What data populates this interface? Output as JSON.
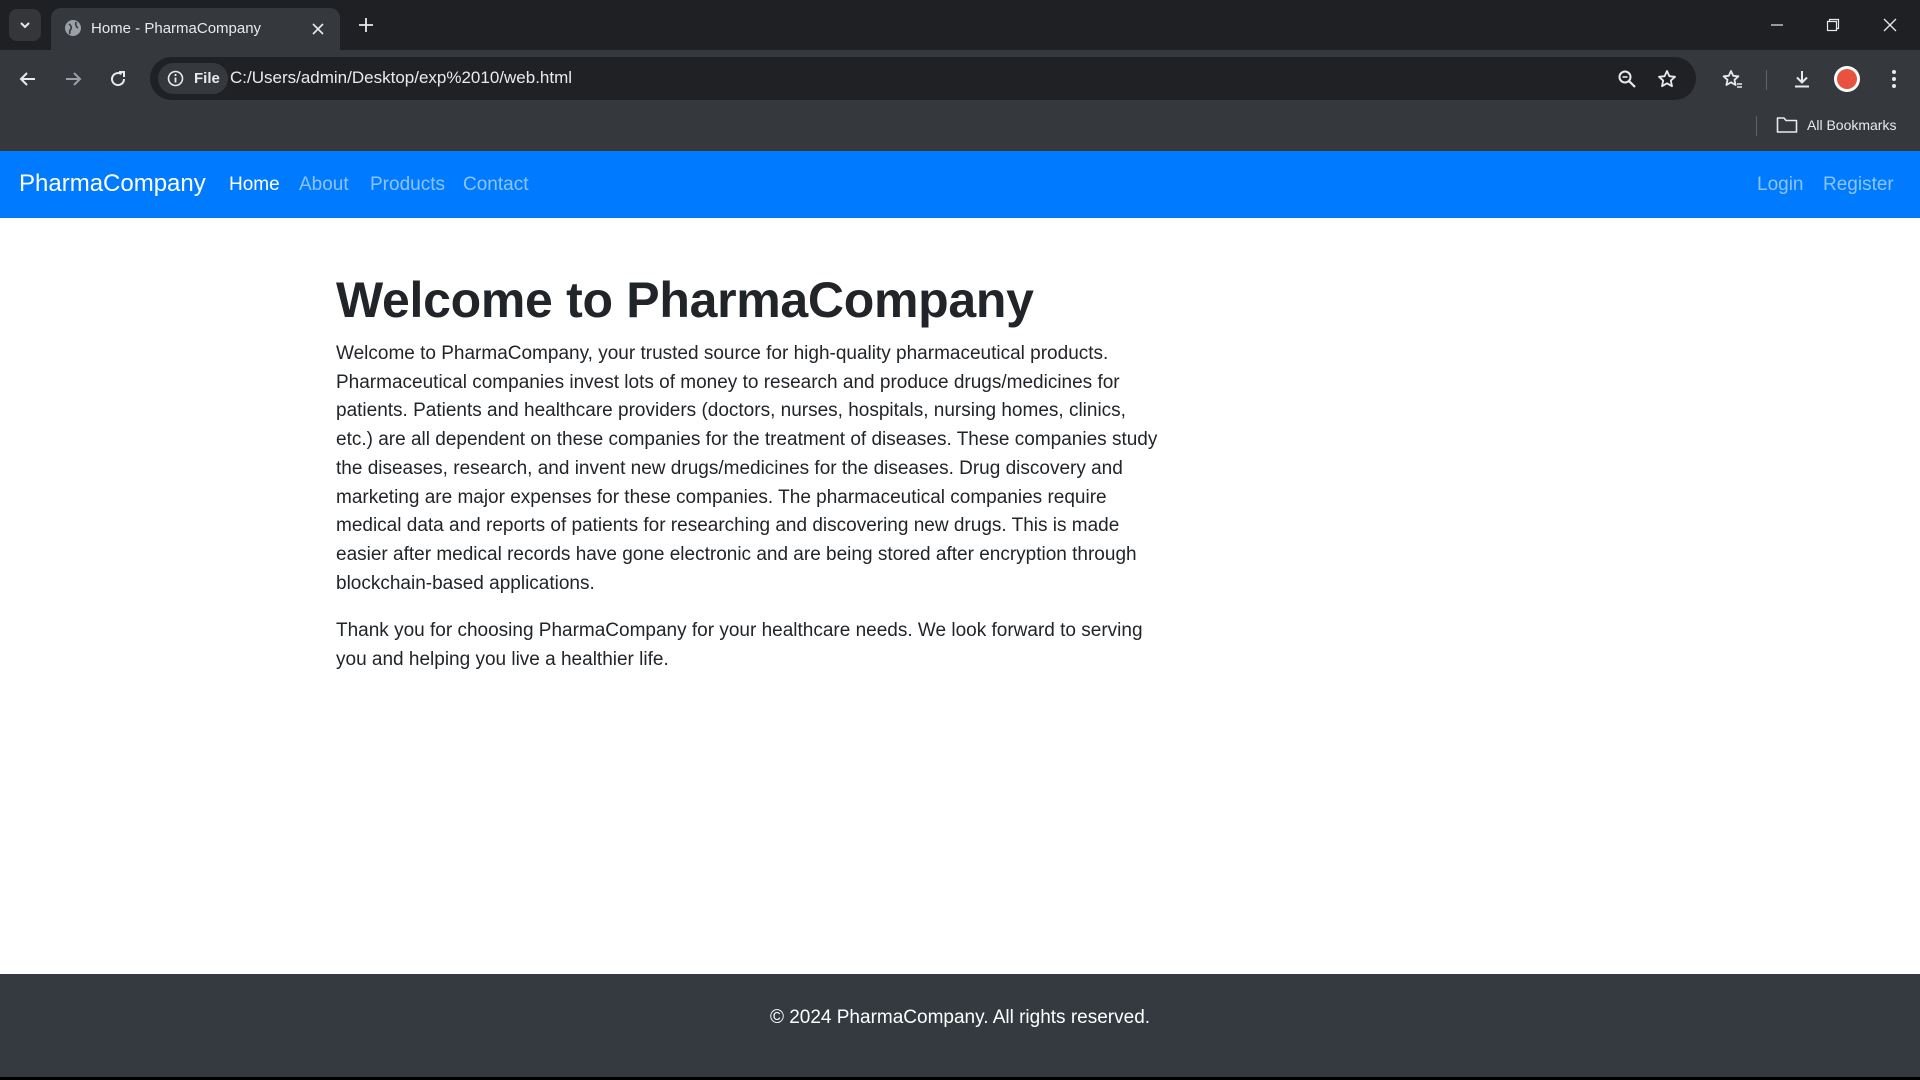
{
  "browser": {
    "tab_title": "Home - PharmaCompany",
    "site_chip_label": "File",
    "url": "C:/Users/admin/Desktop/exp%2010/web.html",
    "bookmarks_label": "All Bookmarks",
    "icons": {
      "tab_menu": "chevron-down-icon",
      "tab_favicon": "globe-icon",
      "tab_close": "close-icon",
      "new_tab": "plus-icon",
      "minimize": "minimize-icon",
      "restore": "restore-icon",
      "close_window": "close-icon",
      "back": "back-arrow-icon",
      "forward": "forward-arrow-icon",
      "reload": "reload-icon",
      "site_info": "info-icon",
      "zoom": "zoom-icon",
      "bookmark_star": "star-icon",
      "bookmarks_manager": "star-list-icon",
      "downloads": "download-icon",
      "profile": "avatar-icon",
      "menu": "kebab-menu-icon",
      "bookmarks_folder": "folder-icon"
    }
  },
  "site": {
    "brand": "PharmaCompany",
    "nav": {
      "home": "Home",
      "about": "About",
      "products": "Products",
      "contact": "Contact",
      "login": "Login",
      "register": "Register"
    },
    "heading": "Welcome to PharmaCompany",
    "paragraphs": [
      "Welcome to PharmaCompany, your trusted source for high-quality pharmaceutical products. Pharmaceutical companies invest lots of money to research and produce drugs/medicines for patients. Patients and healthcare providers (doctors, nurses, hospitals, nursing homes, clinics, etc.) are all dependent on these companies for the treatment of diseases. These companies study the diseases, research, and invent new drugs/medicines for the diseases. Drug discovery and marketing are major expenses for these companies. The pharmaceutical companies require medical data and reports of patients for researching and discovering new drugs. This is made easier after medical records have gone electronic and are being stored after encryption through blockchain-based applications.",
      "Thank you for choosing PharmaCompany for your healthcare needs. We look forward to serving you and helping you live a healthier life."
    ],
    "footer": "© 2024 PharmaCompany. All rights reserved."
  },
  "colors": {
    "navbar_bg": "#007bff",
    "footer_bg": "#343a40",
    "text": "#212529",
    "chrome_dark": "#1f2023",
    "chrome_toolbar": "#35383d",
    "omnibox_bg": "#202124"
  }
}
